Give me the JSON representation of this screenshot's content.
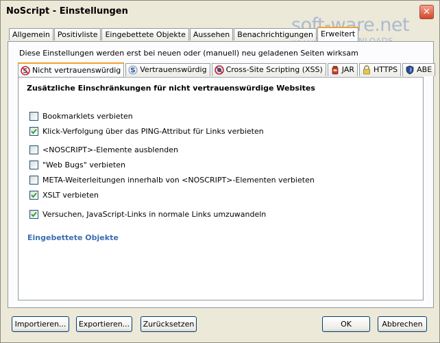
{
  "window": {
    "title": "NoScript - Einstellungen",
    "close_glyph": "✕"
  },
  "watermark": {
    "brand": "soft-ware.net",
    "tagline": "AKTUELLE DOWNLOADS"
  },
  "tabs": [
    {
      "label": "Allgemein",
      "active": false
    },
    {
      "label": "Positivliste",
      "active": false
    },
    {
      "label": "Eingebettete Objekte",
      "active": false
    },
    {
      "label": "Aussehen",
      "active": false
    },
    {
      "label": "Benachrichtigungen",
      "active": false
    },
    {
      "label": "Erweitert",
      "active": true
    }
  ],
  "notice": "Diese Einstellungen werden erst bei neuen oder (manuell) neu geladenen Seiten wirksam",
  "subtabs": [
    {
      "label": "Nicht vertrauenswürdig",
      "icon": "untrusted-s-icon",
      "active": true
    },
    {
      "label": "Vertrauenswürdig",
      "icon": "trusted-s-icon",
      "active": false
    },
    {
      "label": "Cross-Site Scripting (XSS)",
      "icon": "xss-icon",
      "active": false
    },
    {
      "label": "JAR",
      "icon": "jar-icon",
      "active": false
    },
    {
      "label": "HTTPS",
      "icon": "lock-icon",
      "active": false
    },
    {
      "label": "ABE",
      "icon": "shield-icon",
      "active": false
    }
  ],
  "section_heading": "Zusätzliche Einschränkungen für nicht vertrauenswürdige Websites",
  "options": [
    {
      "label": "Bookmarklets verbieten",
      "checked": false
    },
    {
      "label": "Klick-Verfolgung über das PING-Attribut für Links verbieten",
      "checked": true
    },
    {
      "label": "<NOSCRIPT>-Elemente ausblenden",
      "checked": false
    },
    {
      "label": "\"Web Bugs\" verbieten",
      "checked": false
    },
    {
      "label": "META-Weiterleitungen innerhalb von <NOSCRIPT>-Elementen verbieten",
      "checked": false
    },
    {
      "label": "XSLT verbieten",
      "checked": true
    },
    {
      "label": "Versuchen, JavaScript-Links in normale Links umzuwandeln",
      "checked": true
    }
  ],
  "embedded_link": "Eingebettete Objekte",
  "buttons": {
    "import": "Importieren...",
    "export": "Exportieren...",
    "reset": "Zurücksetzen",
    "ok": "OK",
    "cancel": "Abbrechen"
  },
  "colors": {
    "accent_tab": "#f0a030",
    "link": "#3b6eb0",
    "checkmark": "#21a121"
  }
}
